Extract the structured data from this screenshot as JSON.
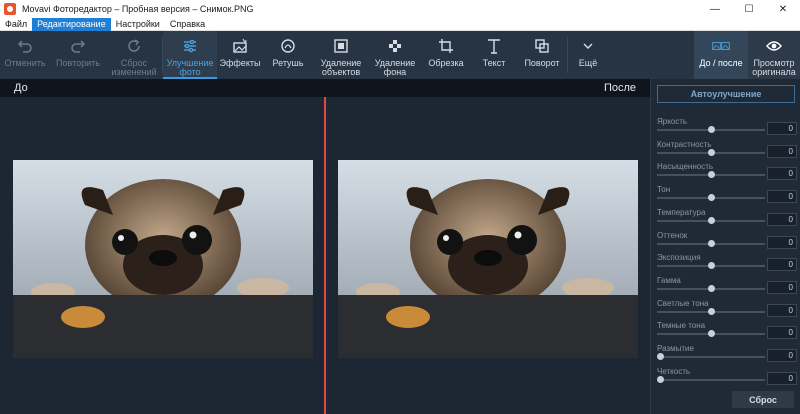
{
  "window": {
    "title": "Movavi Фоторедактор – Пробная версия – Снимок.PNG",
    "minimize": "—",
    "maximize": "☐",
    "close": "✕"
  },
  "menu": [
    {
      "label": "Файл",
      "active": false
    },
    {
      "label": "Редактирование",
      "active": true
    },
    {
      "label": "Настройки",
      "active": false
    },
    {
      "label": "Справка",
      "active": false
    }
  ],
  "toolbar": {
    "undo": "Отменить",
    "redo": "Повторить",
    "reset_changes": "Сброс\nизменений",
    "enhance": "Улучшение\nфото",
    "effects": "Эффекты",
    "retouch": "Ретушь",
    "object_removal": "Удаление\nобъектов",
    "background_removal": "Удаление\nфона",
    "crop": "Обрезка",
    "text": "Текст",
    "rotate": "Поворот",
    "more": "Ещё",
    "before_after": "До / после",
    "view_original": "Просмотр\nоригинала"
  },
  "compare": {
    "before": "До",
    "after": "После"
  },
  "panel": {
    "auto_enhance": "Автоулучшение",
    "reset": "Сброс",
    "sliders": [
      {
        "name": "Яркость",
        "value": "0",
        "level": 0.5
      },
      {
        "name": "Контрастность",
        "value": "0",
        "level": 0.5
      },
      {
        "name": "Насыщенность",
        "value": "0",
        "level": 0.5
      },
      {
        "name": "Тон",
        "value": "0",
        "level": 0.5
      },
      {
        "name": "Температура",
        "value": "0",
        "level": 0.5
      },
      {
        "name": "Оттенок",
        "value": "0",
        "level": 0.5
      },
      {
        "name": "Экспозиция",
        "value": "0",
        "level": 0.5
      },
      {
        "name": "Гамма",
        "value": "0",
        "level": 0.5
      },
      {
        "name": "Светлые тона",
        "value": "0",
        "level": 0.5
      },
      {
        "name": "Темные тона",
        "value": "0",
        "level": 0.5
      },
      {
        "name": "Размытие",
        "value": "0",
        "level": 0.0
      },
      {
        "name": "Четкость",
        "value": "0",
        "level": 0.0
      }
    ]
  },
  "colors": {
    "accent": "#3a9ae0",
    "divider": "#e8463a",
    "menu_active": "#1e7fd6"
  }
}
